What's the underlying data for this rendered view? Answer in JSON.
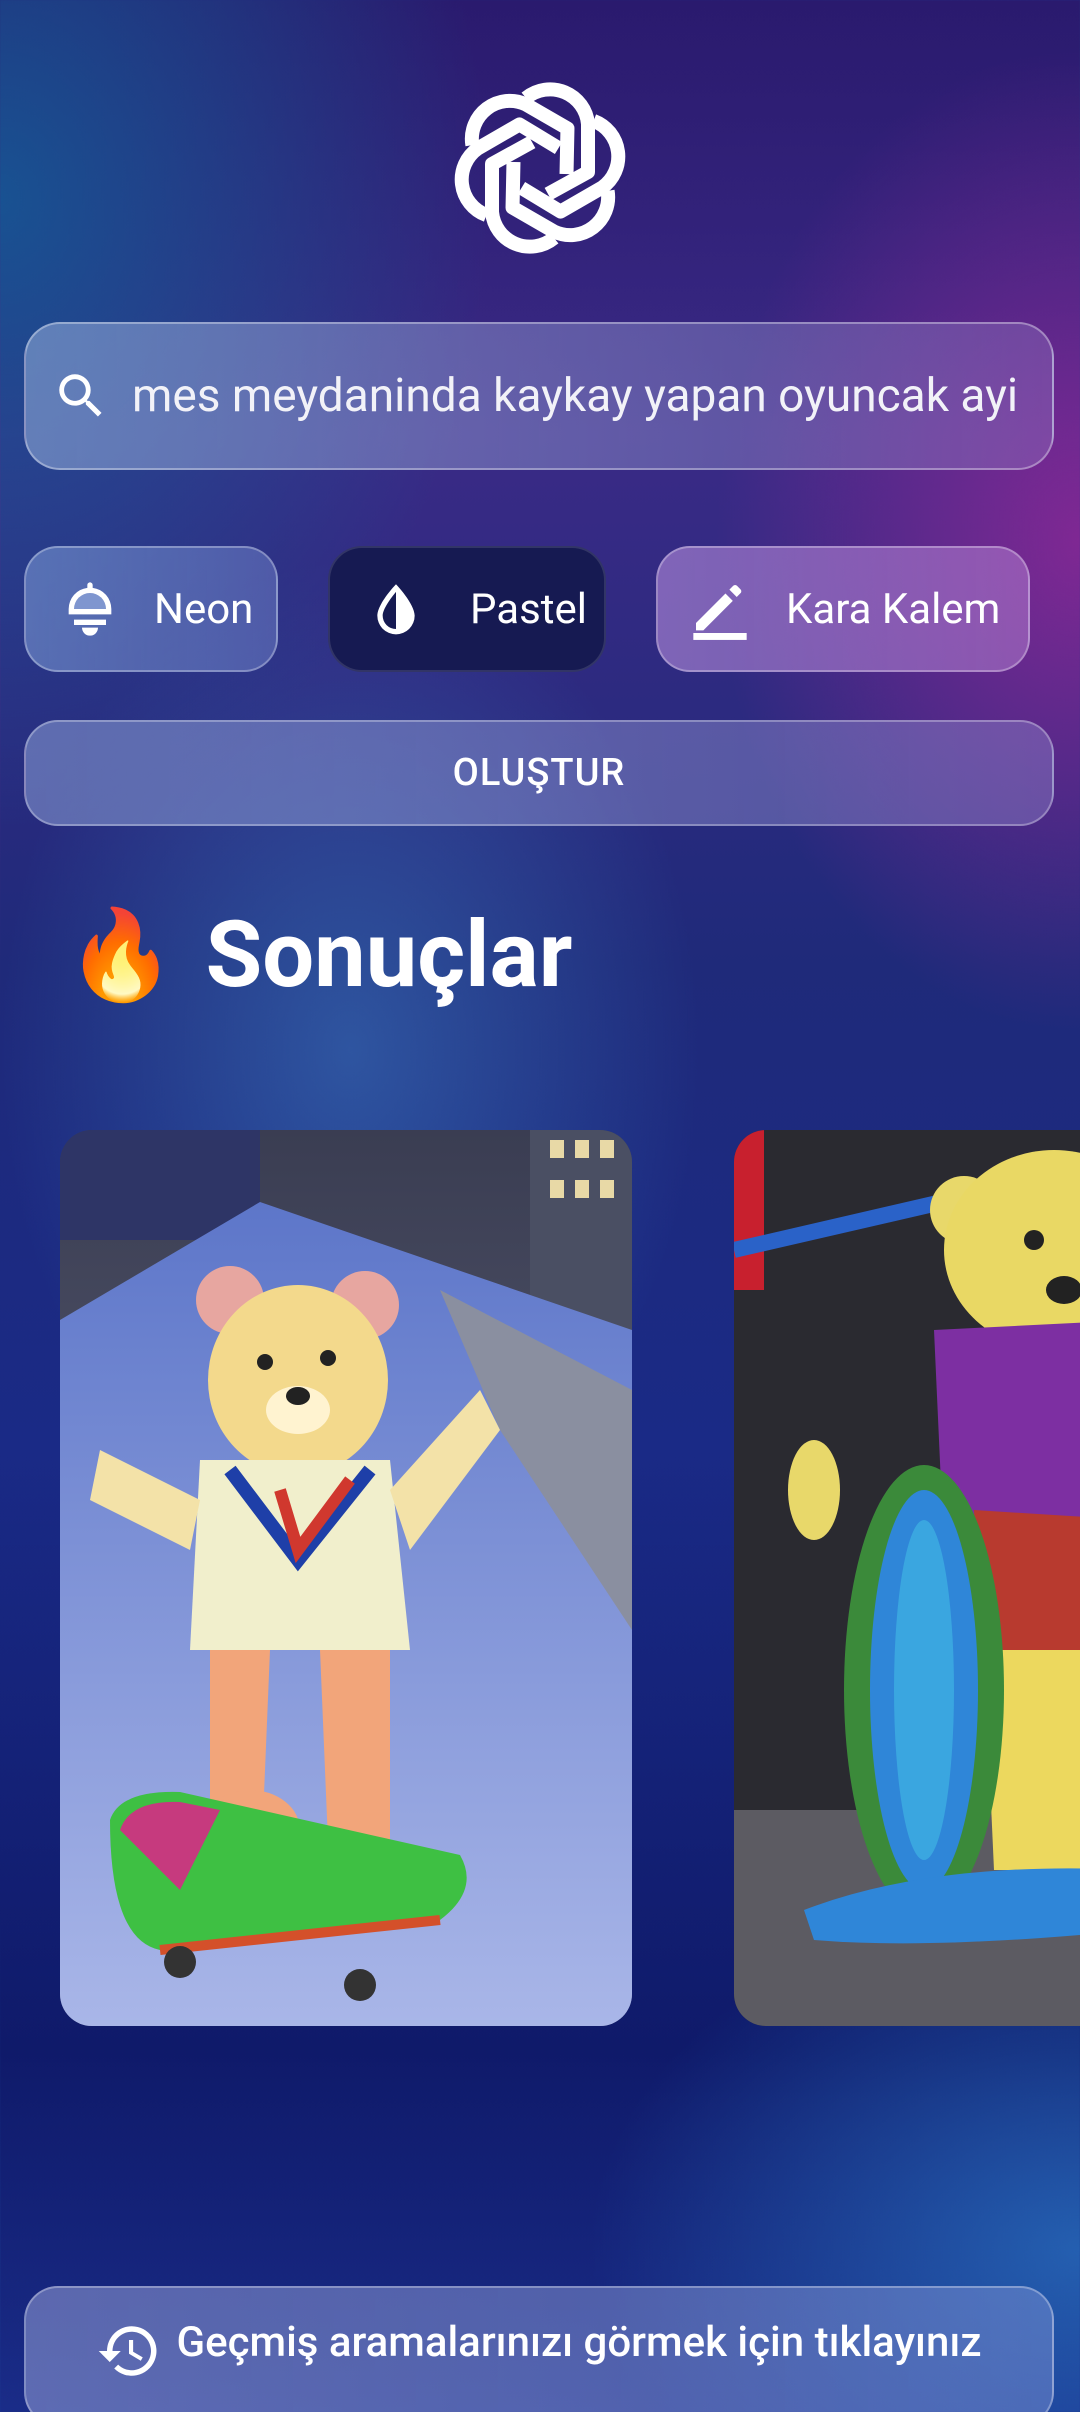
{
  "app": {
    "logo_icon": "openai-logo-icon"
  },
  "search": {
    "value": "mes meydaninda kaykay yapan oyuncak ayi",
    "icon": "search-icon"
  },
  "styles": [
    {
      "label": "Neon",
      "icon": "lamp-icon",
      "selected": false
    },
    {
      "label": "Pastel",
      "icon": "drop-icon",
      "selected": true
    },
    {
      "label": "Kara Kalem",
      "icon": "pencil-icon",
      "selected": false
    }
  ],
  "create_button": {
    "label": "OLUŞTUR"
  },
  "results": {
    "emoji": "🔥",
    "title": "Sonuçlar",
    "images": [
      {
        "alt": "teddy bear skateboarding in city square pastel drawing"
      },
      {
        "alt": "teddy bear with rainbow skateboard pastel drawing"
      }
    ]
  },
  "history_button": {
    "label": "Geçmiş aramalarınızı görmek için tıklayınız",
    "icon": "history-icon"
  },
  "colors": {
    "selected_chip": "#161a52",
    "accent_purple": "#8c2896"
  }
}
